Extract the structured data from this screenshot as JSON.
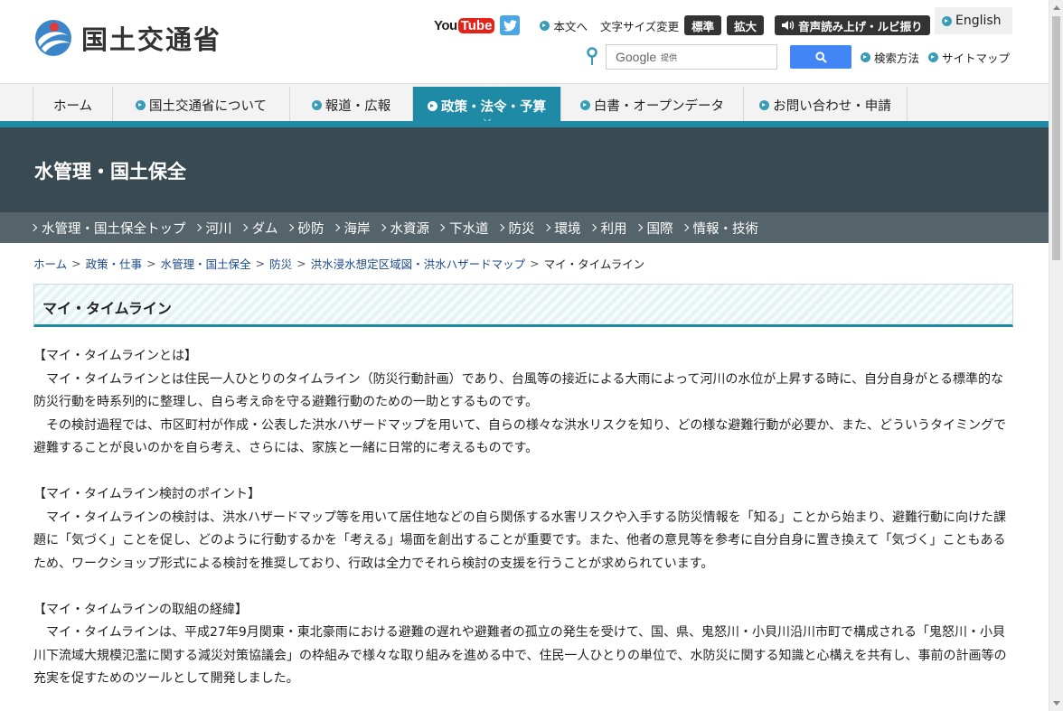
{
  "header": {
    "logo_text": "国土交通省",
    "youtube_you": "You",
    "youtube_tube": "Tube",
    "skip_link": "本文へ",
    "font_size_label": "文字サイズ変更",
    "font_standard": "標準",
    "font_large": "拡大",
    "speech_button": "音声読み上げ・ルビ振り",
    "english": "English",
    "search_brand": "Google",
    "search_brand_sub": "提供",
    "search_help": "検索方法",
    "sitemap": "サイトマップ"
  },
  "gnav": {
    "items": [
      {
        "label": "ホーム"
      },
      {
        "label": "国土交通省について"
      },
      {
        "label": "報道・広報"
      },
      {
        "label": "政策・法令・予算"
      },
      {
        "label": "白書・オープンデータ"
      },
      {
        "label": "お問い合わせ・申請"
      }
    ]
  },
  "banner": {
    "title": "水管理・国土保全"
  },
  "subnav": {
    "items": [
      {
        "label": "水管理・国土保全トップ"
      },
      {
        "label": "河川"
      },
      {
        "label": "ダム"
      },
      {
        "label": "砂防"
      },
      {
        "label": "海岸"
      },
      {
        "label": "水資源"
      },
      {
        "label": "下水道"
      },
      {
        "label": "防災"
      },
      {
        "label": "環境"
      },
      {
        "label": "利用"
      },
      {
        "label": "国際"
      },
      {
        "label": "情報・技術"
      }
    ]
  },
  "breadcrumb": {
    "items": [
      "ホーム",
      "政策・仕事",
      "水管理・国土保全",
      "防災",
      "洪水浸水想定区域図・洪水ハザードマップ"
    ],
    "current": "マイ・タイムライン",
    "separator": ">"
  },
  "page": {
    "title": "マイ・タイムライン",
    "sections": [
      {
        "heading": "【マイ・タイムラインとは】",
        "paragraphs": [
          "　マイ・タイムラインとは住民一人ひとりのタイムライン（防災行動計画）であり、台風等の接近による大雨によって河川の水位が上昇する時に、自分自身がとる標準的な防災行動を時系列的に整理し、自ら考え命を守る避難行動のための一助とするものです。",
          "　その検討過程では、市区町村が作成・公表した洪水ハザードマップを用いて、自らの様々な洪水リスクを知り、どの様な避難行動が必要か、また、どういうタイミングで避難することが良いのかを自ら考え、さらには、家族と一緒に日常的に考えるものです。"
        ]
      },
      {
        "heading": "【マイ・タイムライン検討のポイント】",
        "paragraphs": [
          "　マイ・タイムラインの検討は、洪水ハザードマップ等を用いて居住地などの自ら関係する水害リスクや入手する防災情報を「知る」ことから始まり、避難行動に向けた課題に「気づく」ことを促し、どのように行動するかを「考える」場面を創出することが重要です。また、他者の意見等を参考に自分自身に置き換えて「気づく」こともあるため、ワークショップ形式による検討を推奨しており、行政は全力でそれら検討の支援を行うことが求められています。"
        ]
      },
      {
        "heading": "【マイ・タイムラインの取組の経緯】",
        "paragraphs": [
          "　マイ・タイムラインは、平成27年9月関東・東北豪雨における避難の遅れや避難者の孤立の発生を受けて、国、県、鬼怒川・小貝川沿川市町で構成される「鬼怒川・小貝川下流域大規模氾濫に関する減災対策協議会」の枠組みで様々な取り組みを進める中で、住民一人ひとりの単位で、水防災に関する知識と心構えを共有し、事前の計画等の充実を促すためのツールとして開発しました。"
        ]
      }
    ]
  },
  "colors": {
    "accent": "#1e8aa6",
    "banner": "#3a4a52",
    "subnav": "#55636a"
  }
}
